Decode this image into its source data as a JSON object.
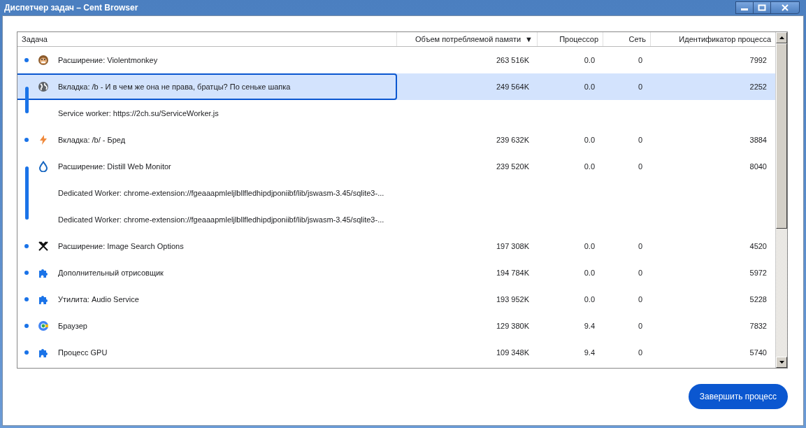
{
  "window": {
    "title": "Диспетчер задач – Cent Browser"
  },
  "table": {
    "columns": [
      {
        "label": "Задача",
        "sorted": false
      },
      {
        "label": "Объем потребляемой памяти",
        "sorted": true
      },
      {
        "label": "Процессор",
        "sorted": false
      },
      {
        "label": "Сеть",
        "sorted": false
      },
      {
        "label": "Идентификатор процесса",
        "sorted": false
      }
    ],
    "sort_indicator": "▼",
    "groups": [
      {
        "rows": [
          {
            "kind": "monkey",
            "task": "Расширение: Violentmonkey",
            "memory": "263 516K",
            "cpu": "0.0",
            "network": "0",
            "pid": "7992",
            "selected": false
          }
        ]
      },
      {
        "rows": [
          {
            "kind": "globe",
            "task": "Вкладка: /b - И в чем же она не права, братцы? По сеньке шапка",
            "memory": "249 564K",
            "cpu": "0.0",
            "network": "0",
            "pid": "2252",
            "selected": true
          },
          {
            "kind": "worker",
            "task": "Service worker: https://2ch.su/ServiceWorker.js",
            "selected": false
          }
        ]
      },
      {
        "rows": [
          {
            "kind": "bolt",
            "task": "Вкладка: /b/ - Бред",
            "memory": "239 632K",
            "cpu": "0.0",
            "network": "0",
            "pid": "3884",
            "selected": false
          }
        ]
      },
      {
        "rows": [
          {
            "kind": "drop",
            "task": "Расширение: Distill Web Monitor",
            "memory": "239 520K",
            "cpu": "0.0",
            "network": "0",
            "pid": "8040",
            "selected": false
          },
          {
            "kind": "worker",
            "task": "Dedicated Worker: chrome-extension://fgeaaapmleljlbllfledhipdjponiibf/lib/jswasm-3.45/sqlite3-...",
            "selected": false
          },
          {
            "kind": "worker",
            "task": "Dedicated Worker: chrome-extension://fgeaaapmleljlbllfledhipdjponiibf/lib/jswasm-3.45/sqlite3-...",
            "selected": false
          }
        ]
      },
      {
        "rows": [
          {
            "kind": "cross",
            "task": "Расширение: Image Search Options",
            "memory": "197 308K",
            "cpu": "0.0",
            "network": "0",
            "pid": "4520",
            "selected": false
          }
        ]
      },
      {
        "rows": [
          {
            "kind": "puzzle",
            "task": "Дополнительный отрисовщик",
            "memory": "194 784K",
            "cpu": "0.0",
            "network": "0",
            "pid": "5972",
            "selected": false
          }
        ]
      },
      {
        "rows": [
          {
            "kind": "puzzle",
            "task": "Утилита: Audio Service",
            "memory": "193 952K",
            "cpu": "0.0",
            "network": "0",
            "pid": "5228",
            "selected": false
          }
        ]
      },
      {
        "rows": [
          {
            "kind": "cent",
            "task": "Браузер",
            "memory": "129 380K",
            "cpu": "9.4",
            "network": "0",
            "pid": "7832",
            "selected": false
          }
        ]
      },
      {
        "rows": [
          {
            "kind": "puzzle",
            "task": "Процесс GPU",
            "memory": "109 348K",
            "cpu": "9.4",
            "network": "0",
            "pid": "5740",
            "selected": false
          }
        ]
      }
    ]
  },
  "end_button": {
    "label": "Завершить процесс"
  }
}
